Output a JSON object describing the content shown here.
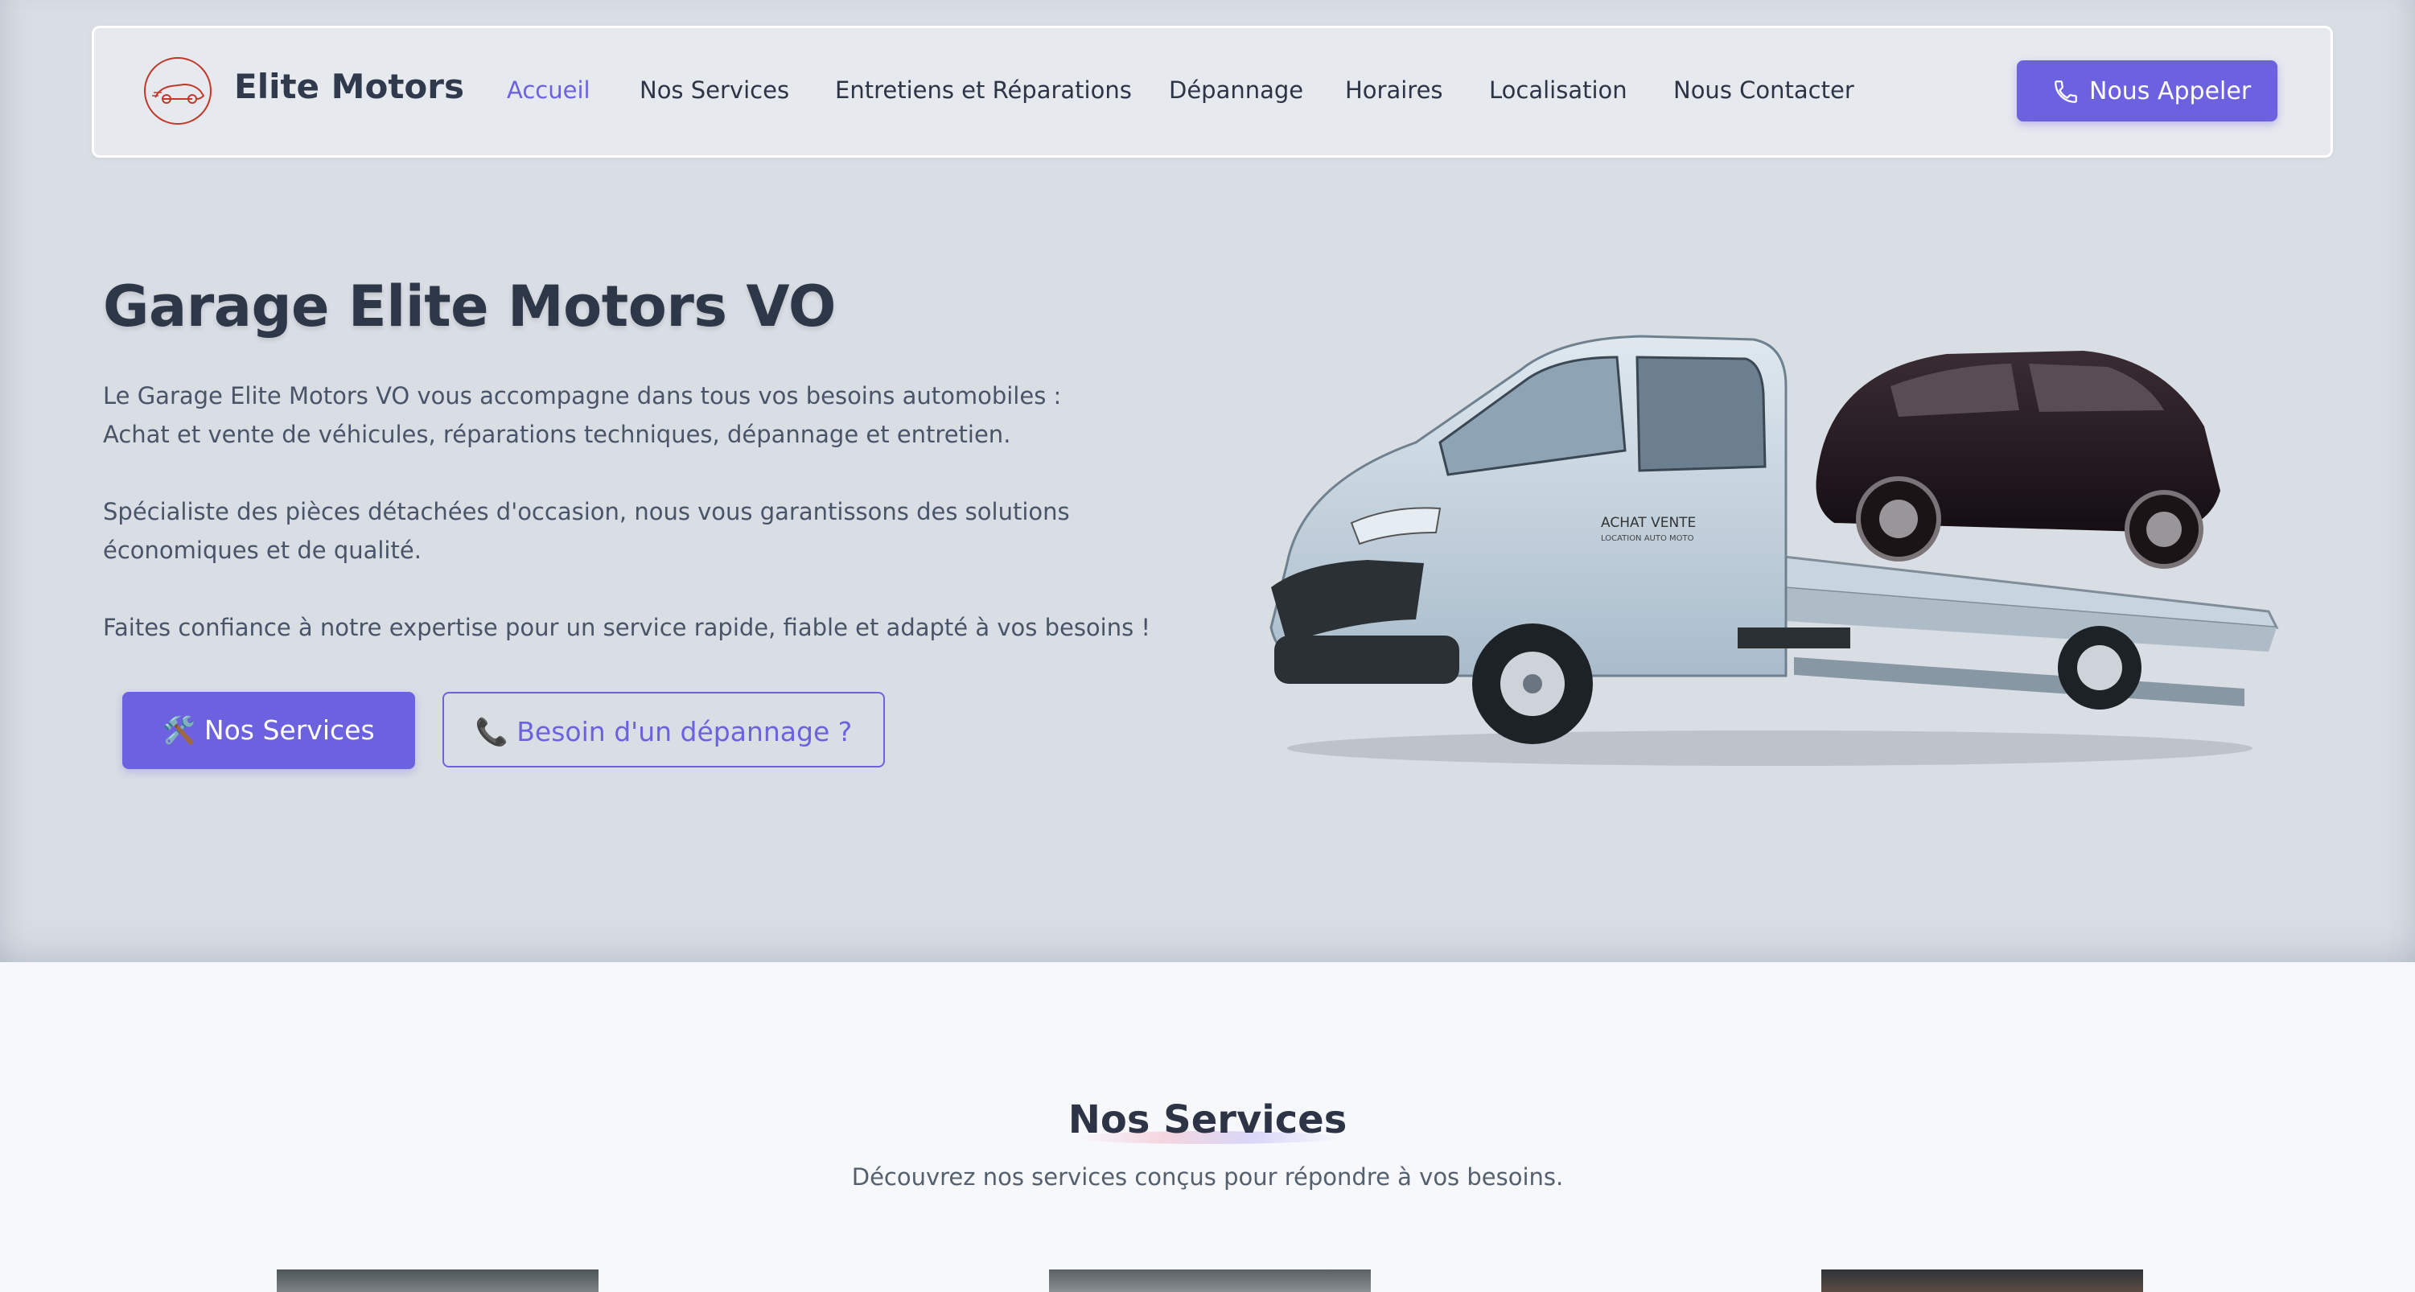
{
  "nav": {
    "brand": "Elite Motors",
    "items": [
      {
        "label": "Accueil",
        "active": true
      },
      {
        "label": "Nos Services"
      },
      {
        "label": "Entretiens et Réparations"
      },
      {
        "label": "Dépannage"
      },
      {
        "label": "Horaires"
      },
      {
        "label": "Localisation"
      },
      {
        "label": "Nous Contacter"
      }
    ],
    "call_button": "Nous Appeler"
  },
  "hero": {
    "title": "Garage Elite Motors VO",
    "para1_line1": "Le Garage Elite Motors VO vous accompagne dans tous vos besoins automobiles :",
    "para1_line2": "Achat et vente de véhicules, réparations techniques, dépannage et entretien.",
    "para2_line1": "Spécialiste des pièces détachées d'occasion, nous vous garantissons des solutions",
    "para2_line2": "économiques et de qualité.",
    "para3": "Faites confiance à notre expertise pour un service rapide, fiable et adapté à vos besoins !",
    "btn_services": "🛠️ Nos Services",
    "btn_depannage": "📞 Besoin d'un dépannage ?",
    "truck_text_line1": "ACHAT  VENTE",
    "truck_text_line2": "LOCATION AUTO MOTO"
  },
  "services": {
    "title": "Nos Services",
    "subtitle": "Découvrez nos services conçus pour répondre à vos besoins."
  },
  "colors": {
    "accent": "#6c62e0",
    "hero_bg": "#d9dde4",
    "text_dark": "#2d3748"
  },
  "icons": {
    "logo": "car-logo-icon",
    "call": "phone-icon"
  }
}
